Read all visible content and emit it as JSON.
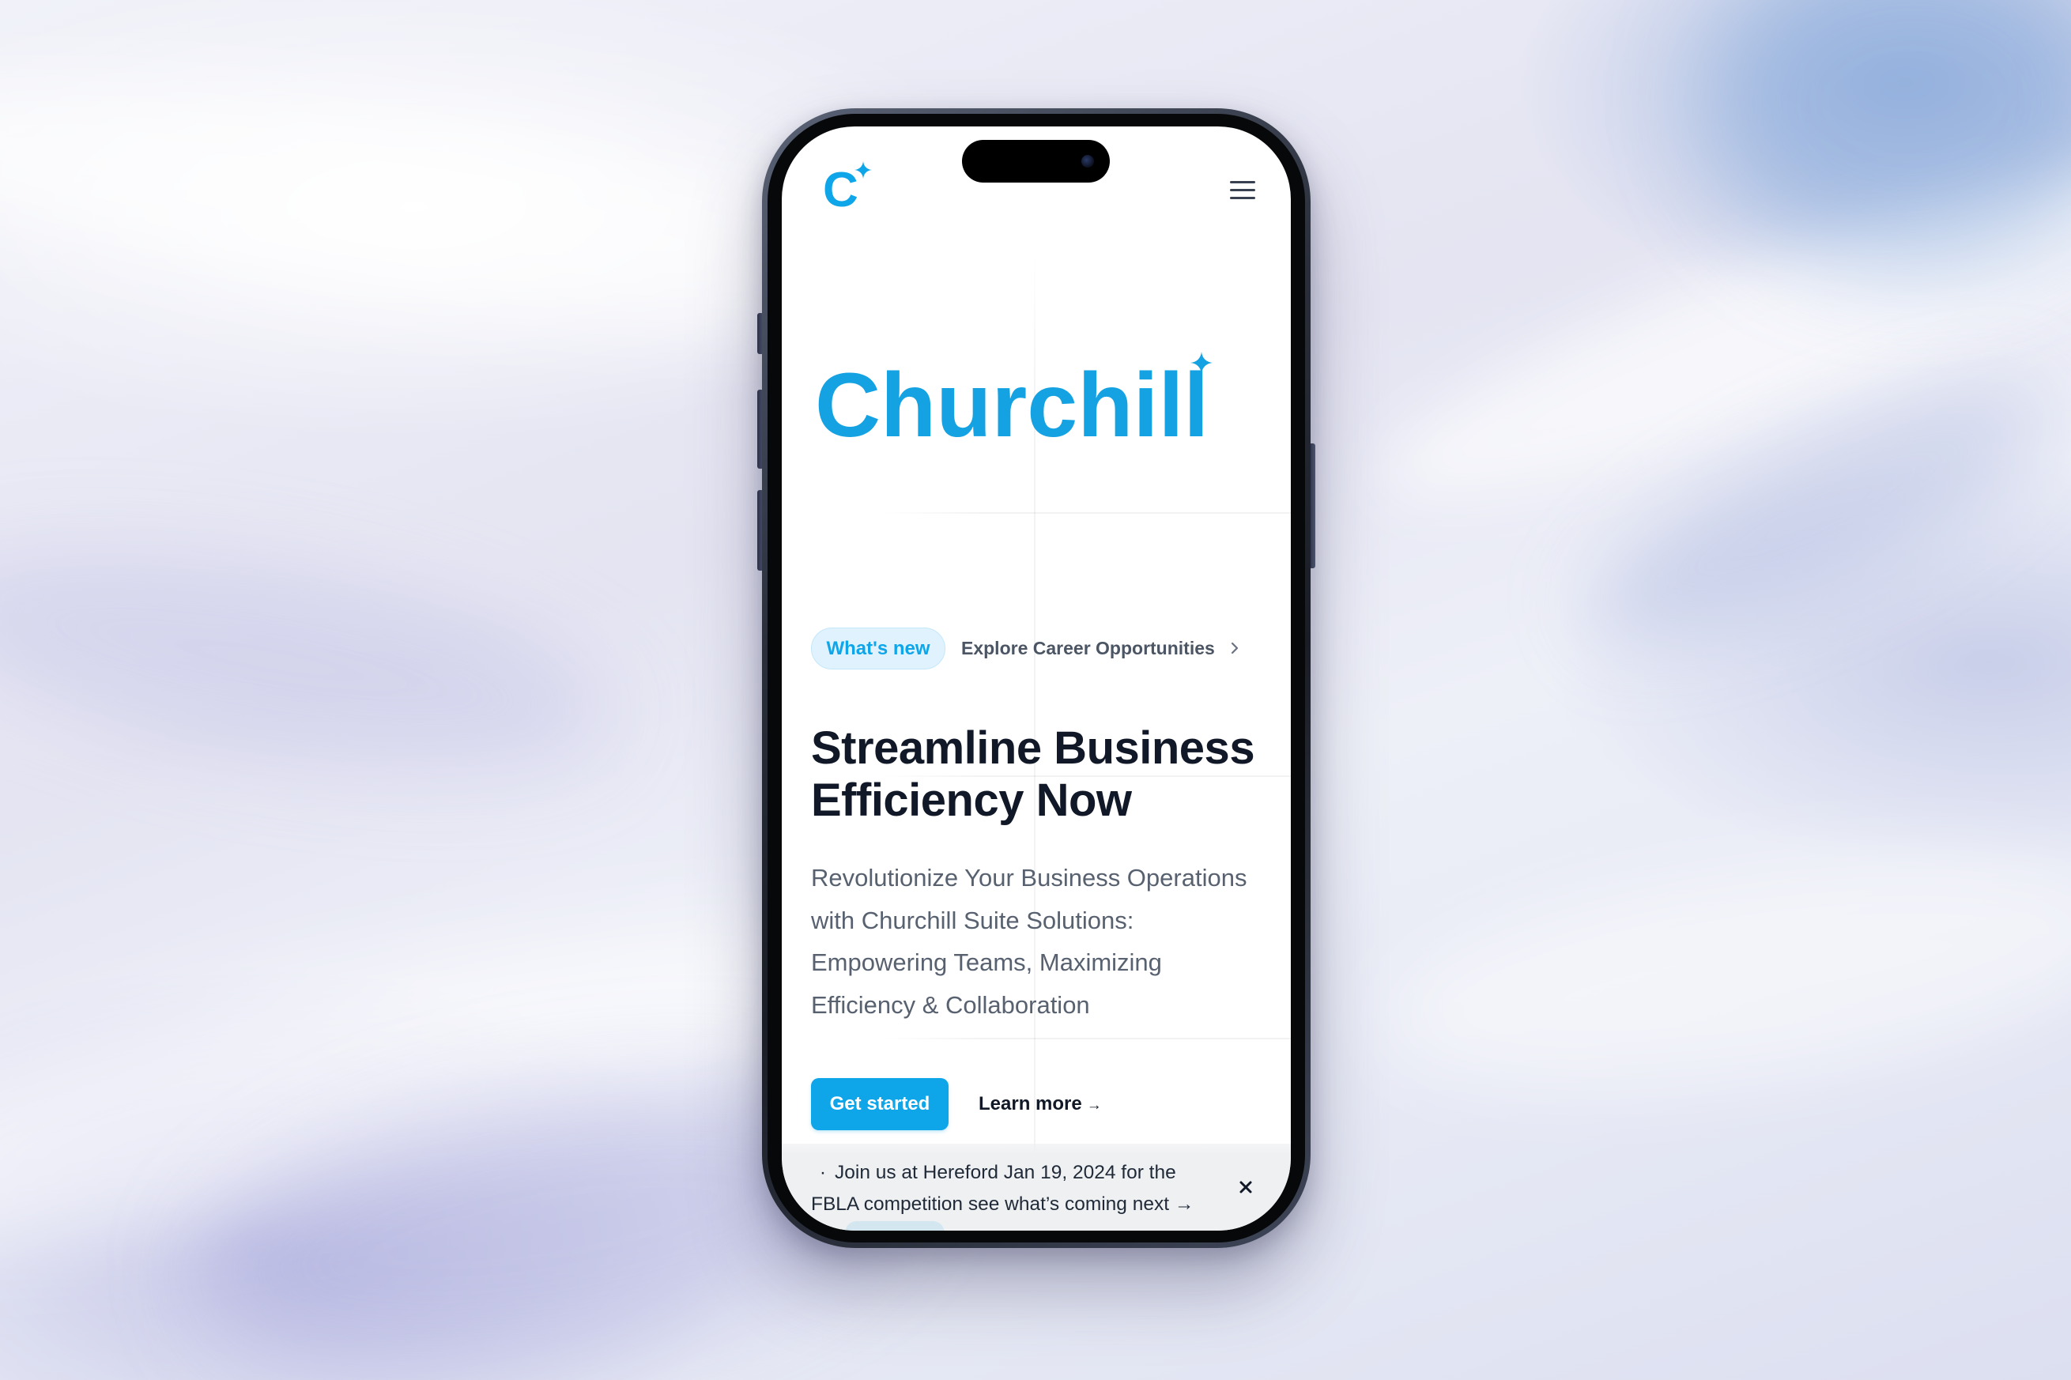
{
  "colors": {
    "brand": "#0ea5e9",
    "wordmark": "#14a2e3",
    "badge_bg": "#e0f2fe",
    "heading": "#111827",
    "body_text": "#586170",
    "banner_bg": "#eff0f2"
  },
  "header": {
    "logo_text": "C",
    "logo_icon": "sparkle-icon",
    "menu_icon": "hamburger-menu-icon"
  },
  "hero": {
    "wordmark": "Churchill",
    "wordmark_icon": "sparkle-icon",
    "announcement": {
      "badge": "What's new",
      "link_label": "Explore Career Opportunities",
      "link_icon": "chevron-right-icon"
    },
    "heading_lines": [
      "Streamline Business",
      "Efficiency Now"
    ],
    "description_lines": [
      "Revolutionize Your Business Operations",
      "with Churchill Suite Solutions:",
      "Empowering Teams, Maximizing",
      "Efficiency & Collaboration"
    ],
    "primary_button": "Get started",
    "secondary_link": {
      "label": "Learn more",
      "arrow": "→"
    }
  },
  "banner": {
    "bullet": "·",
    "lines": [
      "Join us at Hereford Jan 19, 2024 for the",
      "FBLA competition see what’s coming next →"
    ],
    "close_icon": "close-icon"
  }
}
